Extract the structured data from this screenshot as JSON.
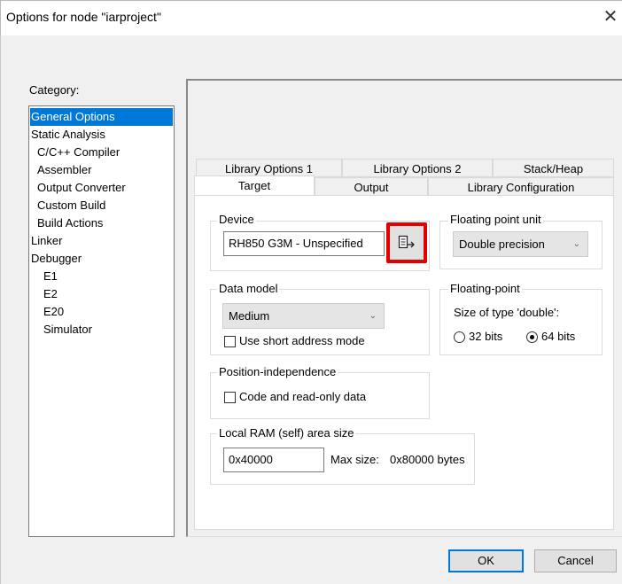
{
  "window": {
    "title": "Options for node \"iarproject\"",
    "close_glyph": "✕"
  },
  "category": {
    "label": "Category:",
    "items": [
      {
        "label": "General Options",
        "selected": true
      },
      {
        "label": "Static Analysis"
      },
      {
        "label": "C/C++ Compiler"
      },
      {
        "label": "Assembler"
      },
      {
        "label": "Output Converter"
      },
      {
        "label": "Custom Build"
      },
      {
        "label": "Build Actions"
      },
      {
        "label": "Linker"
      },
      {
        "label": "Debugger"
      },
      {
        "label": "E1"
      },
      {
        "label": "E2"
      },
      {
        "label": "E20"
      },
      {
        "label": "Simulator"
      }
    ]
  },
  "tabs": {
    "row1": [
      "Library Options 1",
      "Library Options 2",
      "Stack/Heap"
    ],
    "row2": [
      "Target",
      "Output",
      "Library Configuration"
    ],
    "active": "Target"
  },
  "device": {
    "group_title": "Device",
    "value": "RH850 G3M - Unspecified",
    "browse_icon": "device-list-icon"
  },
  "fpu": {
    "group_title": "Floating point unit",
    "selected": "Double precision"
  },
  "data_model": {
    "group_title": "Data model",
    "selected": "Medium",
    "short_address_label": "Use short address mode",
    "short_address_checked": false
  },
  "floating_point": {
    "group_title": "Floating-point",
    "size_label": "Size of type 'double':",
    "option_32": "32 bits",
    "option_64": "64 bits",
    "selected": "64 bits"
  },
  "position_independence": {
    "group_title": "Position-independence",
    "code_label": "Code and read-only data",
    "code_checked": false
  },
  "local_ram": {
    "group_title": "Local RAM (self) area size",
    "value": "0x40000",
    "max_label": "Max size:",
    "max_value": "0x80000 bytes"
  },
  "buttons": {
    "ok": "OK",
    "cancel": "Cancel"
  },
  "colors": {
    "selection": "#0078d7",
    "highlight": "#e30000"
  }
}
